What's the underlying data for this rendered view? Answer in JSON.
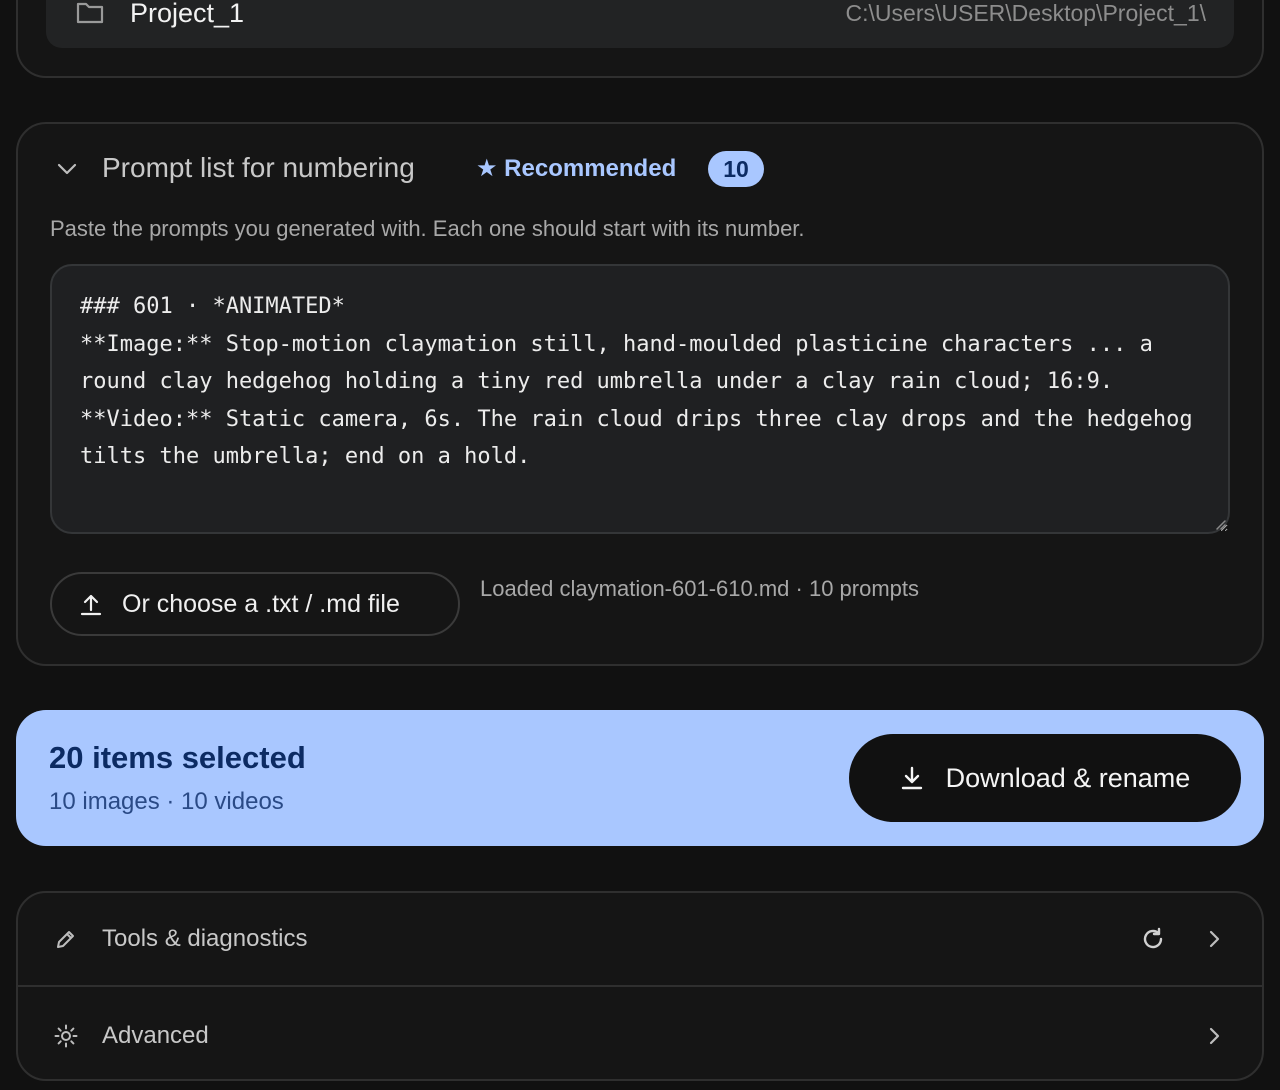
{
  "project": {
    "name": "Project_1",
    "path": "C:\\Users\\USER\\Desktop\\Project_1\\"
  },
  "prompt_list": {
    "title": "Prompt list for numbering",
    "recommended_label": "★ Recommended",
    "count": "10",
    "help_text": "Paste the prompts you generated with. Each one should start with its number.",
    "content": "### 601 · *ANIMATED*\n**Image:** Stop-motion claymation still, hand-moulded plasticine characters ... a round clay hedgehog holding a tiny red umbrella under a clay rain cloud; 16:9.\n**Video:** Static camera, 6s. The rain cloud drips three clay drops and the hedgehog tilts the umbrella; end on a hold.",
    "file_button_label": "Or choose a .txt / .md file",
    "file_status": "Loaded claymation-601-610.md · 10 prompts"
  },
  "selection": {
    "count_label": "20 items selected",
    "detail": "10 images · 10 videos",
    "download_label": "Download & rename"
  },
  "sections": {
    "tools_label": "Tools & diagnostics",
    "advanced_label": "Advanced"
  },
  "colors": {
    "accent": "#a9c7ff",
    "accent_text": "#0c2b63",
    "background": "#111111"
  }
}
